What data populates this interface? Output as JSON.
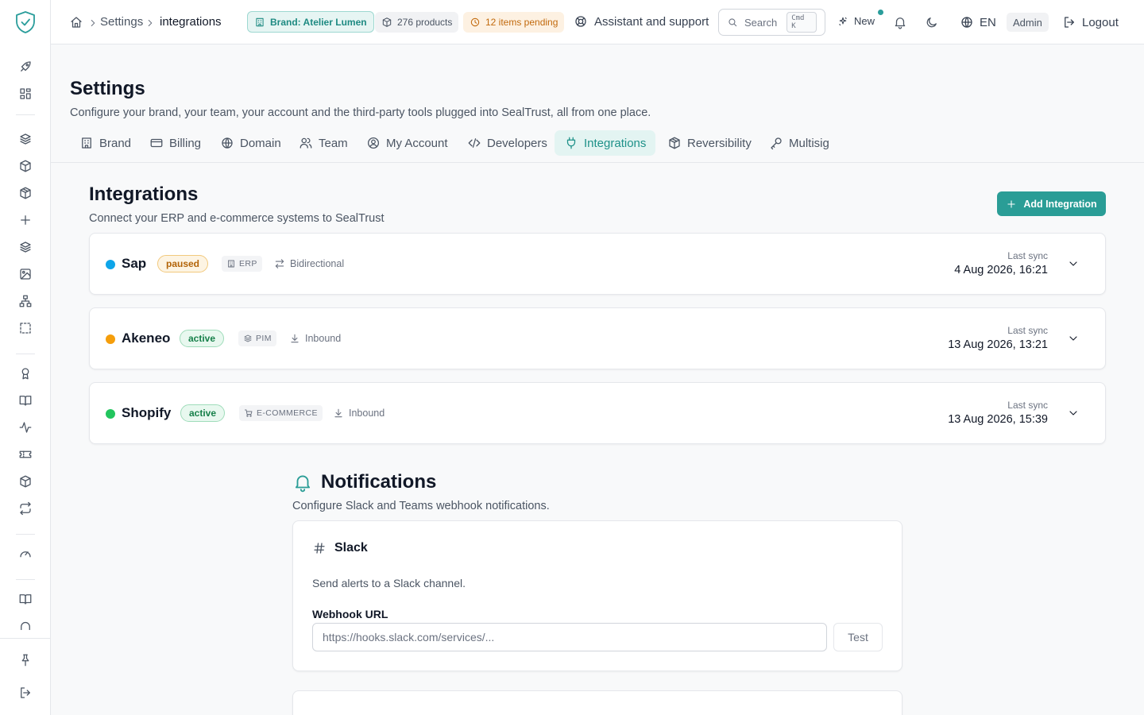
{
  "breadcrumb": {
    "home_icon": "home-icon",
    "section": "Settings",
    "current": "integrations"
  },
  "header": {
    "brand_pill": "Brand: Atelier Lumen",
    "products_pill": "276 products",
    "pending_pill": "12 items pending",
    "support": "Assistant and support",
    "search_label": "Search",
    "search_kbd": "Cmd K",
    "new_label": "New",
    "language": "EN",
    "role": "Admin",
    "logout": "Logout"
  },
  "settings": {
    "title": "Settings",
    "subtitle": "Configure your brand, your team, your account and the third-party tools plugged into SealTrust, all from one place.",
    "tabs": [
      {
        "label": "Brand",
        "icon": "building-icon"
      },
      {
        "label": "Billing",
        "icon": "credit-card-icon"
      },
      {
        "label": "Domain",
        "icon": "globe-icon"
      },
      {
        "label": "Team",
        "icon": "users-icon"
      },
      {
        "label": "My Account",
        "icon": "user-circle-icon"
      },
      {
        "label": "Developers",
        "icon": "code-icon"
      },
      {
        "label": "Integrations",
        "icon": "plug-icon",
        "active": true
      },
      {
        "label": "Reversibility",
        "icon": "package-icon"
      },
      {
        "label": "Multisig",
        "icon": "key-icon"
      }
    ]
  },
  "integrations": {
    "title": "Integrations",
    "subtitle": "Connect your ERP and e-commerce systems to SealTrust",
    "add_button": "Add Integration",
    "last_sync_label": "Last sync",
    "items": [
      {
        "name": "Sap",
        "status": "paused",
        "type": "ERP",
        "direction": "Bidirectional",
        "last_sync": "4 Aug 2026, 16:21",
        "dot_color": "#0ea5e9"
      },
      {
        "name": "Akeneo",
        "status": "active",
        "type": "PIM",
        "direction": "Inbound",
        "last_sync": "13 Aug 2026, 13:21",
        "dot_color": "#f59e0b"
      },
      {
        "name": "Shopify",
        "status": "active",
        "type": "E-COMMERCE",
        "direction": "Inbound",
        "last_sync": "13 Aug 2026, 15:39",
        "dot_color": "#22c55e"
      }
    ]
  },
  "notifications": {
    "title": "Notifications",
    "subtitle": "Configure Slack and Teams webhook notifications.",
    "slack": {
      "title": "Slack",
      "description": "Send alerts to a Slack channel.",
      "webhook_label": "Webhook URL",
      "webhook_placeholder": "https://hooks.slack.com/services/...",
      "test_button": "Test"
    }
  },
  "colors": {
    "accent": "#2a9d96",
    "accent_light": "#e3f4f2"
  }
}
